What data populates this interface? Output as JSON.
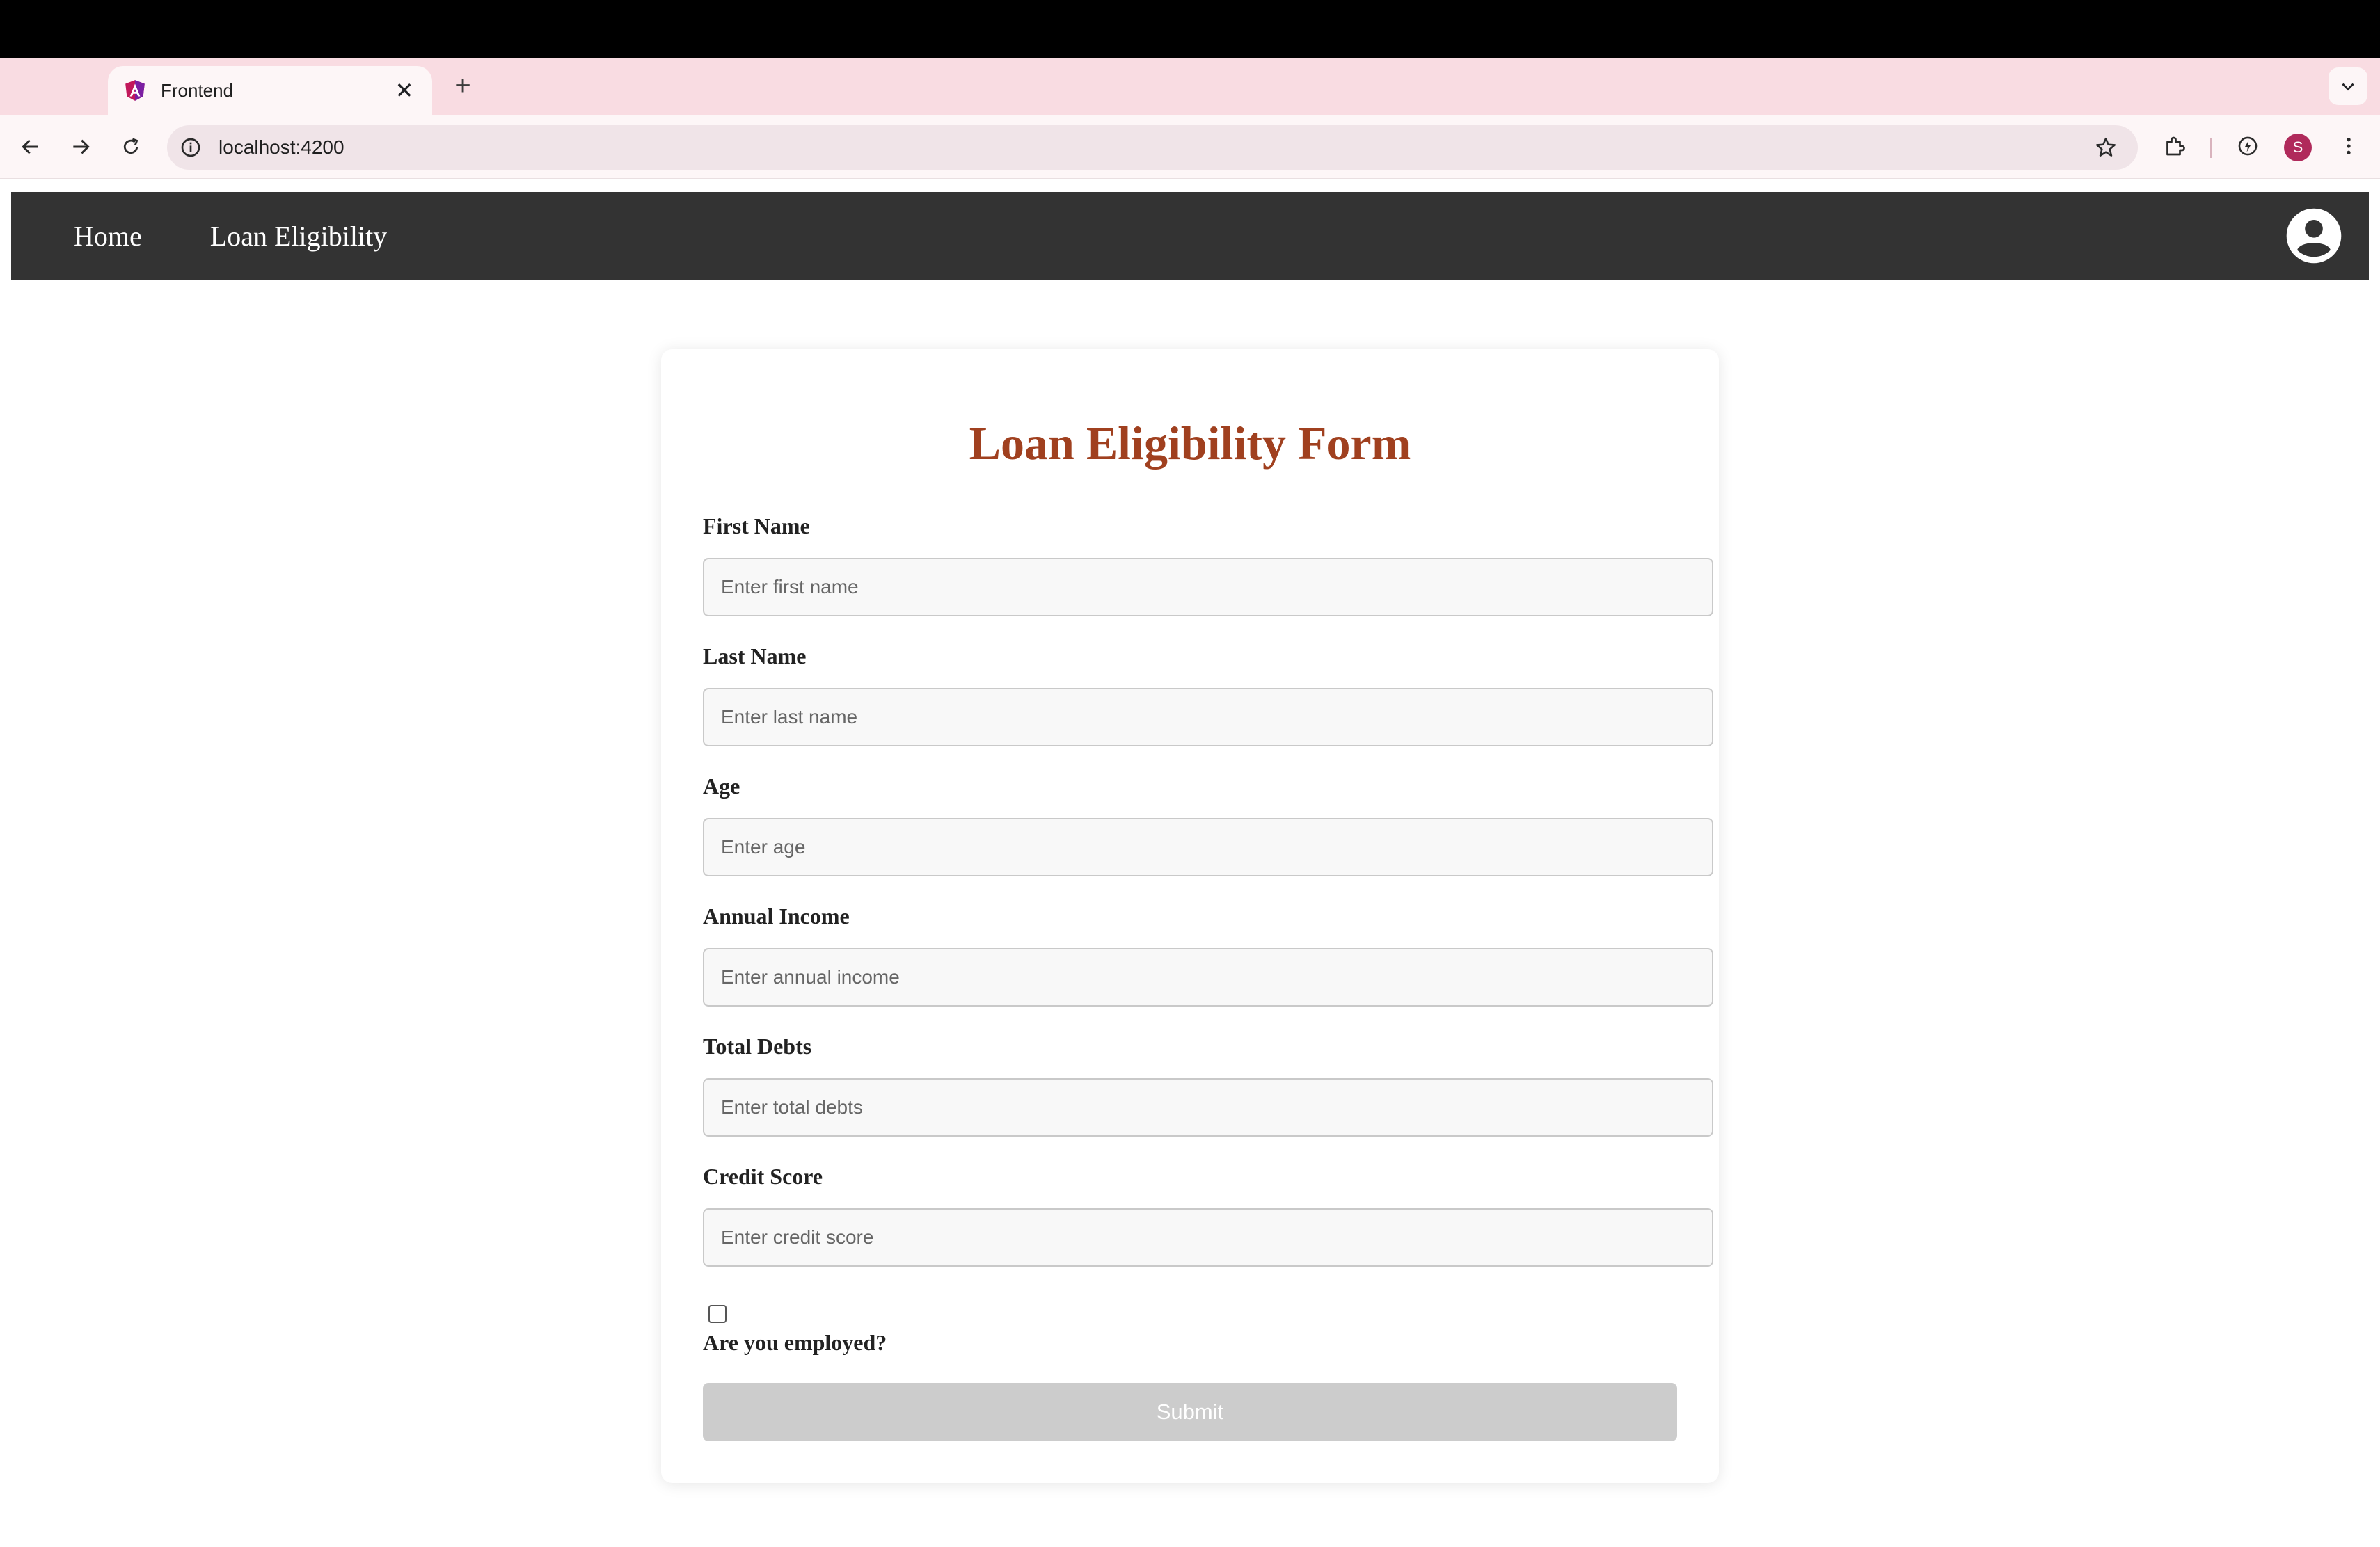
{
  "browser": {
    "tab_title": "Frontend",
    "url": "localhost:4200",
    "profile_initial": "S",
    "new_tab_glyph": "+",
    "close_glyph": "✕"
  },
  "navbar": {
    "links": [
      "Home",
      "Loan Eligibility"
    ]
  },
  "form": {
    "title": "Loan Eligibility Form",
    "fields": [
      {
        "label": "First Name",
        "placeholder": "Enter first name"
      },
      {
        "label": "Last Name",
        "placeholder": "Enter last name"
      },
      {
        "label": "Age",
        "placeholder": "Enter age"
      },
      {
        "label": "Annual Income",
        "placeholder": "Enter annual income"
      },
      {
        "label": "Total Debts",
        "placeholder": "Enter total debts"
      },
      {
        "label": "Credit Score",
        "placeholder": "Enter credit score"
      }
    ],
    "employed_label": "Are you employed?",
    "submit_label": "Submit"
  },
  "colors": {
    "title": "#a0401f",
    "navbar_bg": "#333333",
    "submit_disabled": "#cccccc",
    "tabstrip_bg": "#f9dce2"
  }
}
